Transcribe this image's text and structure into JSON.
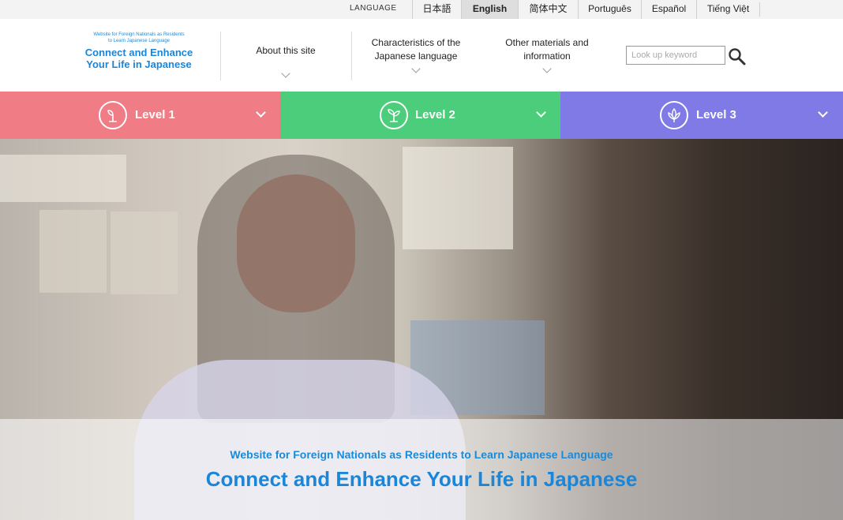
{
  "language_bar": {
    "label": "LANGUAGE",
    "items": [
      {
        "label": "日本語",
        "active": false
      },
      {
        "label": "English",
        "active": true
      },
      {
        "label": "简体中文",
        "active": false
      },
      {
        "label": "Português",
        "active": false
      },
      {
        "label": "Español",
        "active": false
      },
      {
        "label": "Tiếng Việt",
        "active": false
      }
    ]
  },
  "logo": {
    "sub_line1": "Website for Foreign Nationals as Residents",
    "sub_line2": "to Learn Japanese Language",
    "title_line1": "Connect and Enhance",
    "title_line2": "Your Life in Japanese"
  },
  "nav": {
    "items": [
      {
        "line1": "About this site",
        "line2": ""
      },
      {
        "line1": "Characteristics of the",
        "line2": "Japanese language"
      },
      {
        "line1": "Other materials and",
        "line2": "information"
      }
    ]
  },
  "search": {
    "placeholder": "Look up keyword",
    "icon": "search-icon"
  },
  "levels": [
    {
      "label": "Level 1",
      "color": "#f07c85",
      "icon": "sprout-icon"
    },
    {
      "label": "Level 2",
      "color": "#4ccd7b",
      "icon": "seedling-icon"
    },
    {
      "label": "Level 3",
      "color": "#7f7ae6",
      "icon": "lotus-icon"
    }
  ],
  "hero": {
    "subtitle": "Website for Foreign Nationals as Residents to Learn Japanese Language",
    "title": "Connect and Enhance Your Life in Japanese"
  },
  "colors": {
    "brand_blue": "#1a86d9",
    "level1": "#f07c85",
    "level2": "#4ccd7b",
    "level3": "#7f7ae6"
  }
}
